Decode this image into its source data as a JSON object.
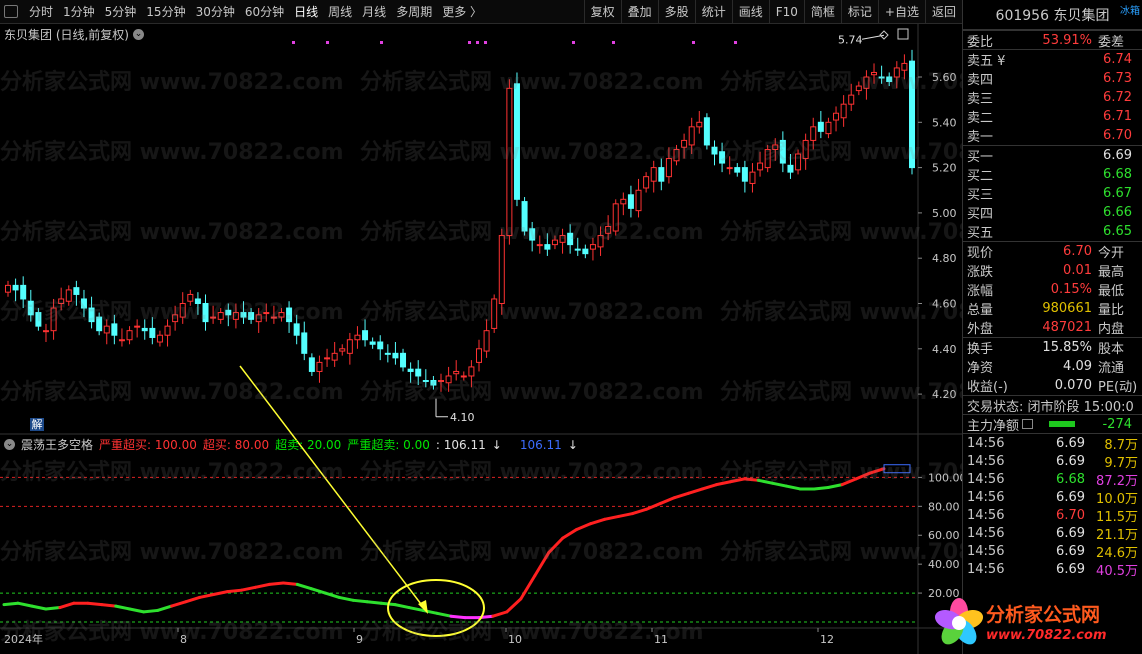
{
  "toolbar": {
    "left_items": [
      "分时",
      "1分钟",
      "5分钟",
      "15分钟",
      "30分钟",
      "60分钟",
      "日线",
      "周线",
      "月线",
      "多周期",
      "更多 〉"
    ],
    "active": "日线",
    "right_items": [
      "复权",
      "叠加",
      "多股",
      "统计",
      "画线",
      "F10",
      "简框",
      "标记",
      "+自选",
      "返回"
    ]
  },
  "chart": {
    "title": "东贝集团 (日线,前复权)",
    "price_axis": [
      "5.60",
      "5.40",
      "5.20",
      "5.00",
      "4.80",
      "4.60",
      "4.40",
      "4.20"
    ],
    "high_label": "5.74",
    "low_label": "4.10",
    "indicator_axis": [
      "100.00",
      "80.00",
      "60.00",
      "40.00",
      "20.00"
    ],
    "date_labels": [
      "2024年",
      "8",
      "9",
      "10",
      "11",
      "12"
    ],
    "badge": "解",
    "indicator": {
      "name": "震荡王多空格",
      "severe_overbought": "严重超买: 100.00",
      "overbought": "超买: 80.00",
      "oversold": "超卖: 20.00",
      "severe_oversold": "严重超卖: 0.00",
      "value": ": 106.11",
      "value2": "106.11"
    },
    "watermark": "分析家公式网 www.70822.com"
  },
  "chart_data": {
    "type": "candlestick",
    "price_range": [
      4.1,
      5.74
    ],
    "indicator_levels": [
      100,
      80,
      20,
      0
    ],
    "indicator_last": 106.11
  },
  "panel": {
    "code": "601956",
    "name": "东贝集团",
    "corner": "冰箱",
    "ratio_label": "委比",
    "ratio_value": "53.91%",
    "ratio_right": "委差",
    "asks": [
      {
        "label": "卖五 ¥",
        "price": "6.74"
      },
      {
        "label": "卖四",
        "price": "6.73"
      },
      {
        "label": "卖三",
        "price": "6.72"
      },
      {
        "label": "卖二",
        "price": "6.71"
      },
      {
        "label": "卖一",
        "price": "6.70"
      }
    ],
    "bids": [
      {
        "label": "买一",
        "price": "6.69"
      },
      {
        "label": "买二",
        "price": "6.68"
      },
      {
        "label": "买三",
        "price": "6.67"
      },
      {
        "label": "买四",
        "price": "6.66"
      },
      {
        "label": "买五",
        "price": "6.65"
      }
    ],
    "quote": [
      {
        "label": "现价",
        "value": "6.70",
        "right": "今开",
        "color": "red"
      },
      {
        "label": "涨跌",
        "value": "0.01",
        "right": "最高",
        "color": "red"
      },
      {
        "label": "涨幅",
        "value": "0.15%",
        "right": "最低",
        "color": "red"
      },
      {
        "label": "总量",
        "value": "980661",
        "right": "量比",
        "color": "yellow"
      },
      {
        "label": "外盘",
        "value": "487021",
        "right": "内盘",
        "color": "red"
      }
    ],
    "stats": [
      {
        "label": "换手",
        "value": "15.85%",
        "right": "股本"
      },
      {
        "label": "净资",
        "value": "4.09",
        "right": "流通"
      },
      {
        "label": "收益(-)",
        "value": "0.070",
        "right": "PE(动)"
      }
    ],
    "status": "交易状态: 闭市阶段 15:00:0",
    "flow_label": "主力净额",
    "flow_value": "-274",
    "trades": [
      {
        "time": "14:56",
        "price": "6.69",
        "vol": "8.7万",
        "pc": "white",
        "vc": "yellow"
      },
      {
        "time": "14:56",
        "price": "6.69",
        "vol": "9.7万",
        "pc": "white",
        "vc": "yellow"
      },
      {
        "time": "14:56",
        "price": "6.68",
        "vol": "87.2万",
        "pc": "green",
        "vc": "magenta"
      },
      {
        "time": "14:56",
        "price": "6.69",
        "vol": "10.0万",
        "pc": "white",
        "vc": "yellow"
      },
      {
        "time": "14:56",
        "price": "6.70",
        "vol": "11.5万",
        "pc": "red",
        "vc": "yellow"
      },
      {
        "time": "14:56",
        "price": "6.69",
        "vol": "21.1万",
        "pc": "white",
        "vc": "yellow"
      },
      {
        "time": "14:56",
        "price": "6.69",
        "vol": "24.6万",
        "pc": "white",
        "vc": "yellow"
      },
      {
        "time": "14:56",
        "price": "6.69",
        "vol": "40.5万",
        "pc": "white",
        "vc": "magenta"
      }
    ]
  },
  "logo": {
    "text": "分析家公式网",
    "url": "www.70822.com"
  }
}
